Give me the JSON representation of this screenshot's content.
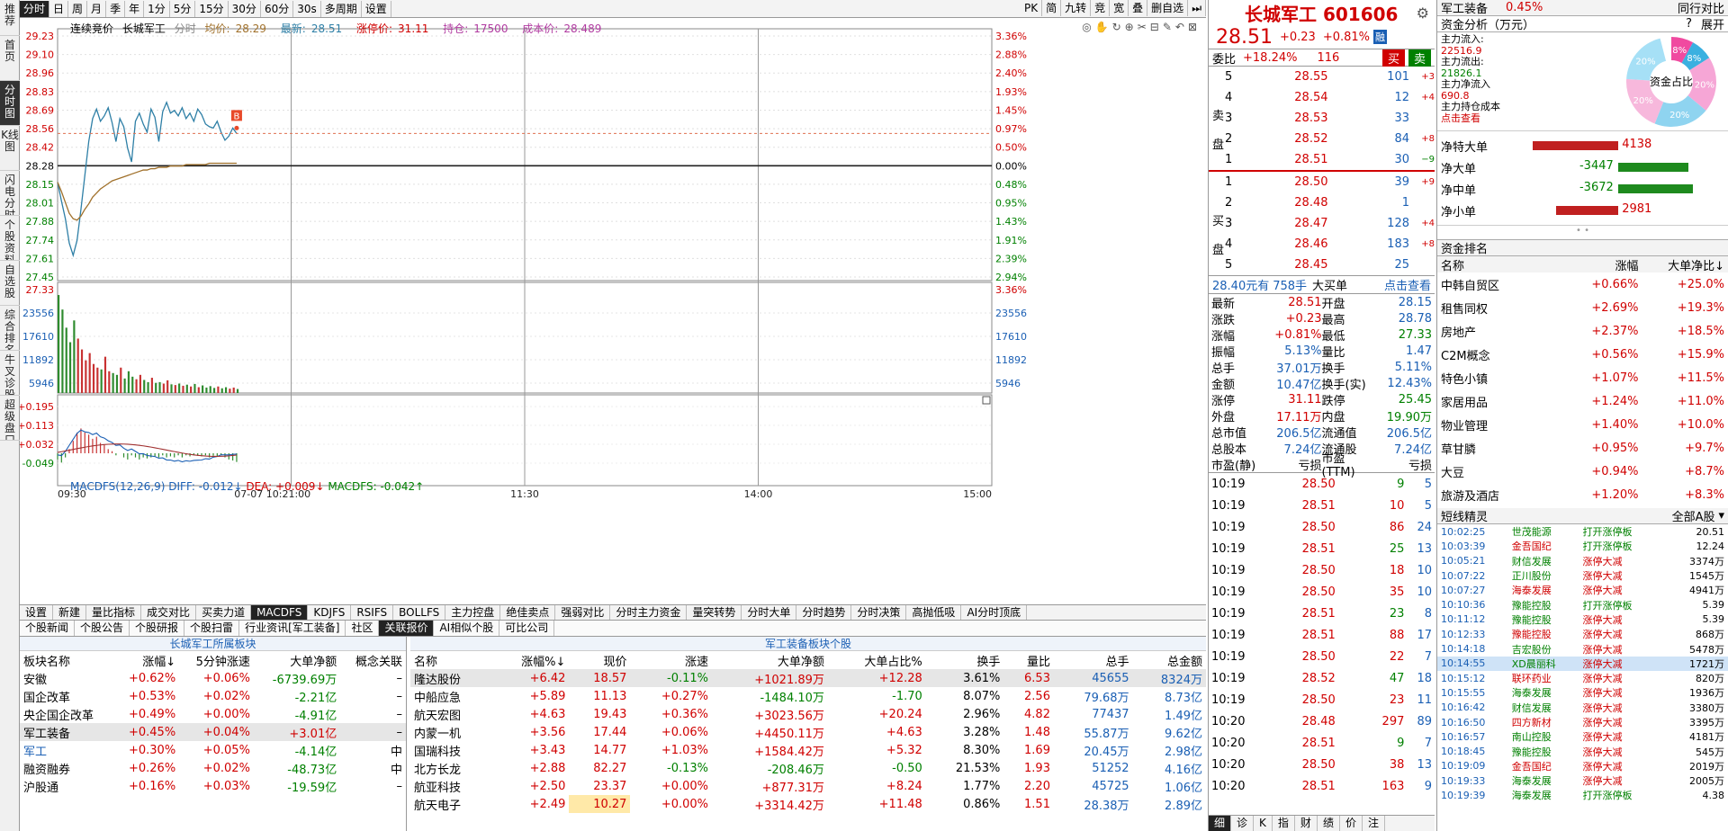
{
  "leftnav": [
    "推荐",
    "首页",
    "分时图",
    "K线图",
    "闪电分时",
    "个股资料",
    "自选股",
    "综合排名",
    "牛叉诊股",
    "超级盘口"
  ],
  "toolbar": {
    "items": [
      "分时",
      "日",
      "周",
      "月",
      "季",
      "年",
      "1分",
      "5分",
      "15分",
      "30分",
      "60分",
      "30s",
      "多周期",
      "设置"
    ],
    "right_items": [
      "PK",
      "简",
      "九转",
      "竞",
      "宽",
      "叠",
      "删自选",
      "⏭"
    ]
  },
  "chart_legend": {
    "mode": "连续竞价",
    "name": "长城军工",
    "fen_shi": "分时",
    "avg_label": "均价:",
    "avg": "28.29",
    "latest_label": "最新:",
    "latest": "28.51",
    "limit_up_label": "涨停价:",
    "limit_up": "31.11",
    "holding_label": "持仓:",
    "holding": "17500",
    "cost_label": "成本价:",
    "cost": "28.489"
  },
  "macd_legend": {
    "name": "MACDFS(12,26,9)",
    "diff": "DIFF: -0.012↓",
    "dea": "DEA: +0.009↓",
    "macdfs": "MACDFS: -0.042↑"
  },
  "price_axis_left": [
    "29.23",
    "29.10",
    "28.96",
    "28.83",
    "28.69",
    "28.56",
    "28.42",
    "28.28",
    "28.15",
    "28.01",
    "27.88",
    "27.74",
    "27.61",
    "27.45"
  ],
  "price_axis_right": [
    "3.36%",
    "2.88%",
    "2.40%",
    "1.93%",
    "1.45%",
    "0.97%",
    "0.50%",
    "0.00%",
    "0.48%",
    "0.95%",
    "1.43%",
    "1.91%",
    "2.39%",
    "2.94%"
  ],
  "vol_axis_left": [
    "27.33",
    "23556",
    "17610",
    "11892",
    "5946"
  ],
  "vol_axis_right": [
    "3.36%",
    "23556",
    "17610",
    "11892",
    "5946"
  ],
  "macd_axis": [
    "+0.195",
    "+0.113",
    "+0.032",
    "-0.049"
  ],
  "time_axis": [
    "09:30",
    "07-07 10:21:00",
    "11:30",
    "14:00",
    "15:00"
  ],
  "bottom_tabs": [
    "设置",
    "新建",
    "量比指标",
    "成交对比",
    "买卖力道",
    "MACDFS",
    "KDJFS",
    "RSIFS",
    "BOLLFS",
    "主力控盘",
    "绝佳卖点",
    "强弱对比",
    "分时主力资金",
    "量突转势",
    "分时大单",
    "分时趋势",
    "分时决策",
    "高抛低吸",
    "AI分时顶底"
  ],
  "bottom_tabs2": [
    "个股新闻",
    "个股公告",
    "个股研报",
    "个股扫雷",
    "行业资讯[军工装备]",
    "社区",
    "关联报价",
    "AI相似个股",
    "可比公司"
  ],
  "sector_table": {
    "title": "长城军工所属板块",
    "headers": [
      "板块名称",
      "涨幅↓",
      "5分钟涨速",
      "大单净额",
      "概念关联"
    ],
    "rows": [
      [
        "安徽",
        "+0.62%",
        "+0.06%",
        "-6739.69万",
        "–"
      ],
      [
        "国企改革",
        "+0.53%",
        "+0.02%",
        "-2.21亿",
        "–"
      ],
      [
        "央企国企改革",
        "+0.49%",
        "+0.00%",
        "-4.91亿",
        "–"
      ],
      [
        "军工装备",
        "+0.45%",
        "+0.04%",
        "+3.01亿",
        "–"
      ],
      [
        "军工",
        "+0.30%",
        "+0.05%",
        "-4.14亿",
        "中"
      ],
      [
        "融资融券",
        "+0.26%",
        "+0.02%",
        "-48.73亿",
        "中"
      ],
      [
        "沪股通",
        "+0.16%",
        "+0.03%",
        "-19.59亿",
        "–"
      ]
    ]
  },
  "stock_table": {
    "title": "军工装备板块个股",
    "headers": [
      "名称",
      "涨幅%↓",
      "现价",
      "涨速",
      "大单净额",
      "大单占比%",
      "换手",
      "量比",
      "总手",
      "总金额"
    ],
    "rows": [
      [
        "隆达股份",
        "+6.42",
        "18.57",
        "-0.11%",
        "+1021.89万",
        "+12.28",
        "3.61%",
        "6.53",
        "45655",
        "8324万"
      ],
      [
        "中船应急",
        "+5.89",
        "11.13",
        "+0.27%",
        "-1484.10万",
        "-1.70",
        "8.07%",
        "2.56",
        "79.68万",
        "8.73亿"
      ],
      [
        "航天宏图",
        "+4.63",
        "19.43",
        "+0.36%",
        "+3023.56万",
        "+20.24",
        "2.96%",
        "4.82",
        "77437",
        "1.49亿"
      ],
      [
        "内蒙一机",
        "+3.56",
        "17.44",
        "+0.06%",
        "+4450.11万",
        "+4.63",
        "3.28%",
        "1.48",
        "55.87万",
        "9.62亿"
      ],
      [
        "国瑞科技",
        "+3.43",
        "14.77",
        "+1.03%",
        "+1584.42万",
        "+5.32",
        "8.30%",
        "1.69",
        "20.45万",
        "2.98亿"
      ],
      [
        "北方长龙",
        "+2.88",
        "82.27",
        "-0.13%",
        "-208.46万",
        "-0.50",
        "21.53%",
        "1.93",
        "51252",
        "4.16亿"
      ],
      [
        "航亚科技",
        "+2.50",
        "23.37",
        "+0.00%",
        "+877.31万",
        "+8.24",
        "1.77%",
        "2.20",
        "45725",
        "1.06亿"
      ],
      [
        "航天电子",
        "+2.49",
        "10.27",
        "+0.00%",
        "+3314.42万",
        "+11.48",
        "0.86%",
        "1.51",
        "28.38万",
        "2.89亿"
      ]
    ]
  },
  "quote": {
    "title": "长城军工 601606",
    "price": "28.51",
    "change": "+0.23",
    "pct": "+0.81%",
    "market_tag": "融",
    "wb_label": "委比",
    "wb": "+18.24%",
    "wc": "116",
    "buy_btn": "买",
    "sell_btn": "卖",
    "asks": [
      [
        "5",
        "28.55",
        "101",
        "+3"
      ],
      [
        "4",
        "28.54",
        "12",
        "+4"
      ],
      [
        "3",
        "28.53",
        "33",
        ""
      ],
      [
        "2",
        "28.52",
        "84",
        "+8"
      ],
      [
        "1",
        "28.51",
        "30",
        "−9"
      ]
    ],
    "bids": [
      [
        "1",
        "28.50",
        "39",
        "+9"
      ],
      [
        "2",
        "28.48",
        "1",
        ""
      ],
      [
        "3",
        "28.47",
        "128",
        "+4"
      ],
      [
        "4",
        "28.46",
        "183",
        "+8"
      ],
      [
        "5",
        "28.45",
        "25",
        ""
      ]
    ],
    "ask_label": "卖盘",
    "bid_label": "买盘",
    "big_order": {
      "price": "28.40元有",
      "qty": "758手",
      "label": "大买单",
      "link": "点击查看"
    },
    "stats": [
      [
        "最新",
        "28.51",
        "开盘",
        "28.15"
      ],
      [
        "涨跌",
        "+0.23",
        "最高",
        "28.78"
      ],
      [
        "涨幅",
        "+0.81%",
        "最低",
        "27.33"
      ],
      [
        "振幅",
        "5.13%",
        "量比",
        "1.47"
      ],
      [
        "总手",
        "37.01万",
        "换手",
        "5.11%"
      ],
      [
        "金额",
        "10.47亿",
        "换手(实)",
        "12.43%"
      ],
      [
        "涨停",
        "31.11",
        "跌停",
        "25.45"
      ],
      [
        "外盘",
        "17.11万",
        "内盘",
        "19.90万"
      ],
      [
        "总市值",
        "206.5亿",
        "流通值",
        "206.5亿"
      ],
      [
        "总股本",
        "7.24亿",
        "流通股",
        "7.24亿"
      ],
      [
        "市盈(静)",
        "亏损",
        "市盈(TTM)",
        "亏损"
      ]
    ],
    "ticks": [
      [
        "10:19",
        "28.50",
        "9",
        "5"
      ],
      [
        "10:19",
        "28.51",
        "10",
        "5"
      ],
      [
        "10:19",
        "28.50",
        "86",
        "24"
      ],
      [
        "10:19",
        "28.51",
        "25",
        "13"
      ],
      [
        "10:19",
        "28.50",
        "18",
        "10"
      ],
      [
        "10:19",
        "28.50",
        "35",
        "10"
      ],
      [
        "10:19",
        "28.51",
        "23",
        "8"
      ],
      [
        "10:19",
        "28.51",
        "88",
        "17"
      ],
      [
        "10:19",
        "28.50",
        "22",
        "7"
      ],
      [
        "10:19",
        "28.52",
        "47",
        "18"
      ],
      [
        "10:19",
        "28.50",
        "23",
        "11"
      ],
      [
        "10:20",
        "28.48",
        "297",
        "89"
      ],
      [
        "10:20",
        "28.51",
        "9",
        "7"
      ],
      [
        "10:20",
        "28.50",
        "38",
        "13"
      ],
      [
        "10:20",
        "28.51",
        "163",
        "9"
      ]
    ],
    "bottom_tabs": [
      "细",
      "诊",
      "K",
      "指",
      "财",
      "绩",
      "价",
      "注"
    ]
  },
  "side": {
    "sector": "军工装备",
    "sector_pct": "0.45%",
    "peer_label": "同行对比",
    "flow_title": "资金分析（万元）",
    "help": "?",
    "expand": "展开",
    "inflow_label": "主力流入:",
    "inflow": "22516.9",
    "outflow_label": "主力流出:",
    "outflow": "21826.1",
    "net_label": "主力净流入",
    "net": "690.8",
    "cost_label": "主力持仓成本",
    "cost_link": "点击查看",
    "donut_label": "资金占比",
    "donut_pcts": [
      "8%",
      "8%",
      "20%",
      "20%",
      "20%",
      "20%"
    ],
    "flows": [
      [
        "净特大单",
        "4138"
      ],
      [
        "净大单",
        "-3447"
      ],
      [
        "净中单",
        "-3672"
      ],
      [
        "净小单",
        "2981"
      ]
    ],
    "rank_title": "资金排名",
    "rank_headers": [
      "名称",
      "涨幅",
      "大单净比↓"
    ],
    "ranks": [
      [
        "中韩自贸区",
        "+0.66%",
        "+25.0%"
      ],
      [
        "租售同权",
        "+2.69%",
        "+19.3%"
      ],
      [
        "房地产",
        "+2.37%",
        "+18.5%"
      ],
      [
        "C2M概念",
        "+0.56%",
        "+15.9%"
      ],
      [
        "特色小镇",
        "+1.07%",
        "+11.5%"
      ],
      [
        "家居用品",
        "+1.24%",
        "+11.0%"
      ],
      [
        "物业管理",
        "+1.40%",
        "+10.0%"
      ],
      [
        "草甘膦",
        "+0.95%",
        "+9.7%"
      ],
      [
        "大豆",
        "+0.94%",
        "+8.7%"
      ],
      [
        "旅游及酒店",
        "+1.20%",
        "+8.3%"
      ]
    ],
    "sl_title": "短线精灵",
    "sl_filter": "全部A股",
    "shortline": [
      [
        "10:02:25",
        "世茂能源",
        "打开涨停板",
        "20.51"
      ],
      [
        "10:03:39",
        "金吾国纪",
        "打开涨停板",
        "12.24"
      ],
      [
        "10:05:21",
        "财信发展",
        "涨停大减",
        "3374万"
      ],
      [
        "10:07:22",
        "正川股份",
        "涨停大减",
        "1545万"
      ],
      [
        "10:07:27",
        "海泰发展",
        "涨停大减",
        "4941万"
      ],
      [
        "10:10:36",
        "豫能控股",
        "打开涨停板",
        "5.39"
      ],
      [
        "10:11:12",
        "豫能控股",
        "涨停大减",
        "5.39"
      ],
      [
        "10:12:33",
        "豫能控股",
        "涨停大减",
        "868万"
      ],
      [
        "10:14:18",
        "吉宏股份",
        "涨停大减",
        "5478万"
      ],
      [
        "10:14:55",
        "XD晨丽科",
        "涨停大减",
        "1721万"
      ],
      [
        "10:15:12",
        "联环药业",
        "涨停大减",
        "820万"
      ],
      [
        "10:15:55",
        "海泰发展",
        "涨停大减",
        "1936万"
      ],
      [
        "10:16:42",
        "财信发展",
        "涨停大减",
        "3380万"
      ],
      [
        "10:16:50",
        "四方新材",
        "涨停大减",
        "3395万"
      ],
      [
        "10:16:57",
        "南山控股",
        "涨停大减",
        "4181万"
      ],
      [
        "10:18:45",
        "豫能控股",
        "涨停大减",
        "545万"
      ],
      [
        "10:19:09",
        "金吾国纪",
        "涨停大减",
        "2019万"
      ],
      [
        "10:19:33",
        "海泰发展",
        "涨停大减",
        "2005万"
      ],
      [
        "10:19:39",
        "海泰发展",
        "打开涨停板",
        "4.38"
      ]
    ]
  },
  "colors": {
    "up": "#d00000",
    "down": "#008000",
    "price_line": "#2e7fa6",
    "avg_line": "#a0702a",
    "accent": "#1a5fb4"
  }
}
